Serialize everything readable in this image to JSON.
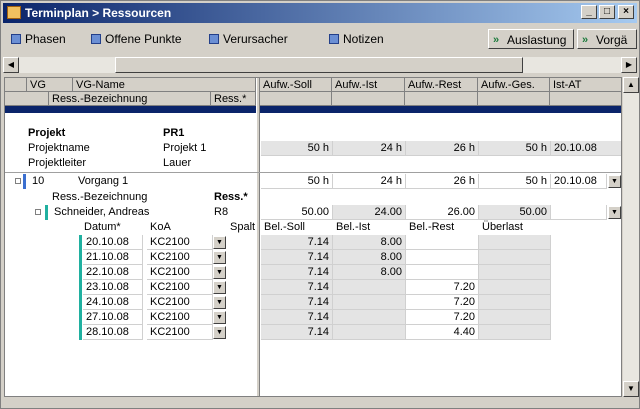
{
  "window": {
    "title": "Terminplan > Ressourcen"
  },
  "toolbar": {
    "left": [
      "Phasen",
      "Offene Punkte",
      "Verursacher",
      "Notizen"
    ],
    "right": [
      "Auslastung",
      "Vorgä"
    ]
  },
  "header": {
    "vg": "VG",
    "vg_name": "VG-Name",
    "res_bez": "Ress.-Bezeichnung",
    "res": "Ress.*",
    "cols": [
      "Aufw.-Soll",
      "Aufw.-Ist",
      "Aufw.-Rest",
      "Aufw.-Ges.",
      "Ist-AT"
    ]
  },
  "project": {
    "label": "Projekt",
    "value": "PR1",
    "name_label": "Projektname",
    "name_value": "Projekt 1",
    "lead_label": "Projektleiter",
    "lead_value": "Lauer",
    "values": [
      "50 h",
      "24 h",
      "26 h",
      "50 h",
      "20.10.08"
    ]
  },
  "task": {
    "id": "10",
    "name": "Vorgang 1",
    "values": [
      "50 h",
      "24 h",
      "26 h",
      "50 h",
      "20.10.08"
    ]
  },
  "resource_header": {
    "bez": "Ress.-Bezeichnung",
    "res": "Ress.*"
  },
  "resource": {
    "name": "Schneider, Andreas",
    "code": "R8",
    "values": [
      "50.00",
      "24.00",
      "26.00",
      "50.00"
    ]
  },
  "load_header": {
    "datum": "Datum*",
    "koa": "KoA",
    "spalt": "Spalt",
    "soll": "Bel.-Soll",
    "ist": "Bel.-Ist",
    "rest": "Bel.-Rest",
    "ueber": "Überlast"
  },
  "load_rows": [
    {
      "date": "20.10.08",
      "koa": "KC2100",
      "soll": "7.14",
      "ist": "8.00",
      "rest": ""
    },
    {
      "date": "21.10.08",
      "koa": "KC2100",
      "soll": "7.14",
      "ist": "8.00",
      "rest": ""
    },
    {
      "date": "22.10.08",
      "koa": "KC2100",
      "soll": "7.14",
      "ist": "8.00",
      "rest": ""
    },
    {
      "date": "23.10.08",
      "koa": "KC2100",
      "soll": "7.14",
      "ist": "",
      "rest": "7.20"
    },
    {
      "date": "24.10.08",
      "koa": "KC2100",
      "soll": "7.14",
      "ist": "",
      "rest": "7.20"
    },
    {
      "date": "27.10.08",
      "koa": "KC2100",
      "soll": "7.14",
      "ist": "",
      "rest": "7.20"
    },
    {
      "date": "28.10.08",
      "koa": "KC2100",
      "soll": "7.14",
      "ist": "",
      "rest": "4.40"
    }
  ]
}
